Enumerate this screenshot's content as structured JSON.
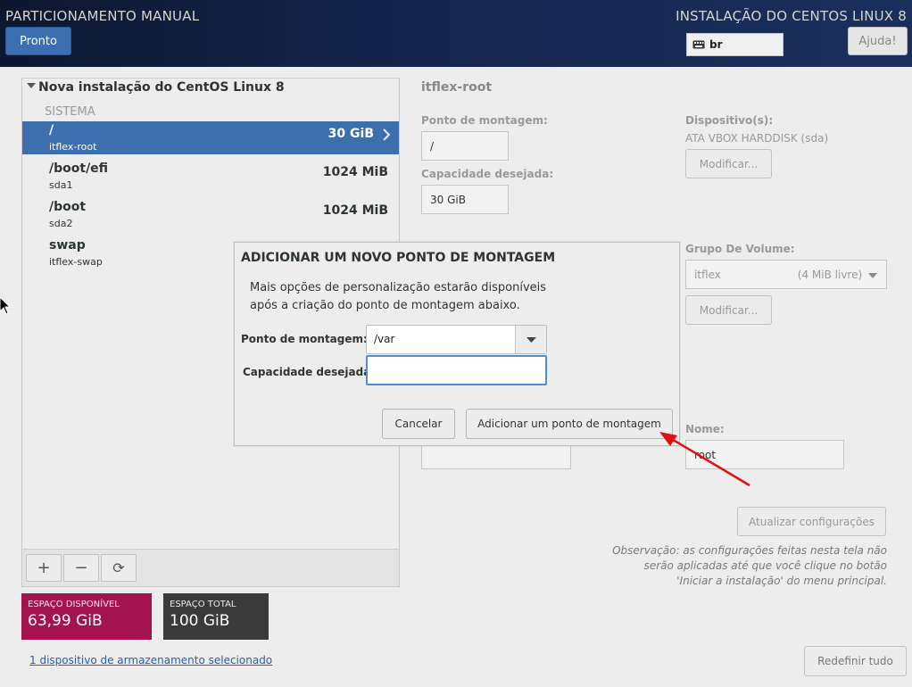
{
  "header": {
    "title_left": "PARTICIONAMENTO MANUAL",
    "title_right": "INSTALAÇÃO DO CENTOS LINUX 8",
    "done_label": "Pronto",
    "keyboard_layout": "br",
    "help_label": "Ajuda!"
  },
  "left_panel": {
    "install_title": "Nova instalação do CentOS Linux 8",
    "section_label": "SISTEMA",
    "mount_points": [
      {
        "name": "/",
        "device": "itflex-root",
        "size": "30 GiB"
      },
      {
        "name": "/boot/efi",
        "device": "sda1",
        "size": "1024 MiB"
      },
      {
        "name": "/boot",
        "device": "sda2",
        "size": "1024 MiB"
      },
      {
        "name": "swap",
        "device": "itflex-swap",
        "size": ""
      }
    ],
    "toolbar": {
      "add": "+",
      "remove": "−",
      "refresh": "⟳"
    }
  },
  "space": {
    "available_label": "ESPAÇO DISPONÍVEL",
    "available_value": "63,99 GiB",
    "total_label": "ESPAÇO TOTAL",
    "total_value": "100 GiB"
  },
  "storage_link": "1 dispositivo de armazenamento selecionado",
  "details": {
    "device_title": "itflex-root",
    "mount_point_label": "Ponto de montagem:",
    "mount_point_value": "/",
    "capacity_label": "Capacidade desejada:",
    "capacity_value": "30 GiB",
    "devices_label": "Dispositivo(s):",
    "devices_value": "ATA VBOX HARDDISK (sda)",
    "modify_label": "Modificar...",
    "volume_group_label": "Grupo De Volume:",
    "volume_group_name": "itflex",
    "volume_group_free": "(4 MiB livre)",
    "modify_vg_label": "Modificar...",
    "name_label": "Nome:",
    "name_value": "root",
    "update_label": "Atualizar configurações",
    "note": "Observação:  as configurações feitas nesta tela não serão aplicadas até que você clique no botão 'Iniciar a instalação' do menu principal.",
    "reset_label": "Redefinir tudo"
  },
  "dialog": {
    "title": "ADICIONAR UM NOVO PONTO DE MONTAGEM",
    "description": "Mais opções de personalização estarão disponíveis após a criação do ponto de montagem abaixo.",
    "mount_point_label": "Ponto de montagem:",
    "mount_point_value": "/var",
    "capacity_label": "Capacidade desejada:",
    "capacity_value": "",
    "cancel_label": "Cancelar",
    "add_label": "Adicionar um ponto de montagem"
  },
  "colors": {
    "header_bg": "#14264d",
    "selected_row": "#3d6fae",
    "available_bg": "#a3144f",
    "total_bg": "#3a3a3a",
    "annotation_arrow": "#e01010"
  }
}
